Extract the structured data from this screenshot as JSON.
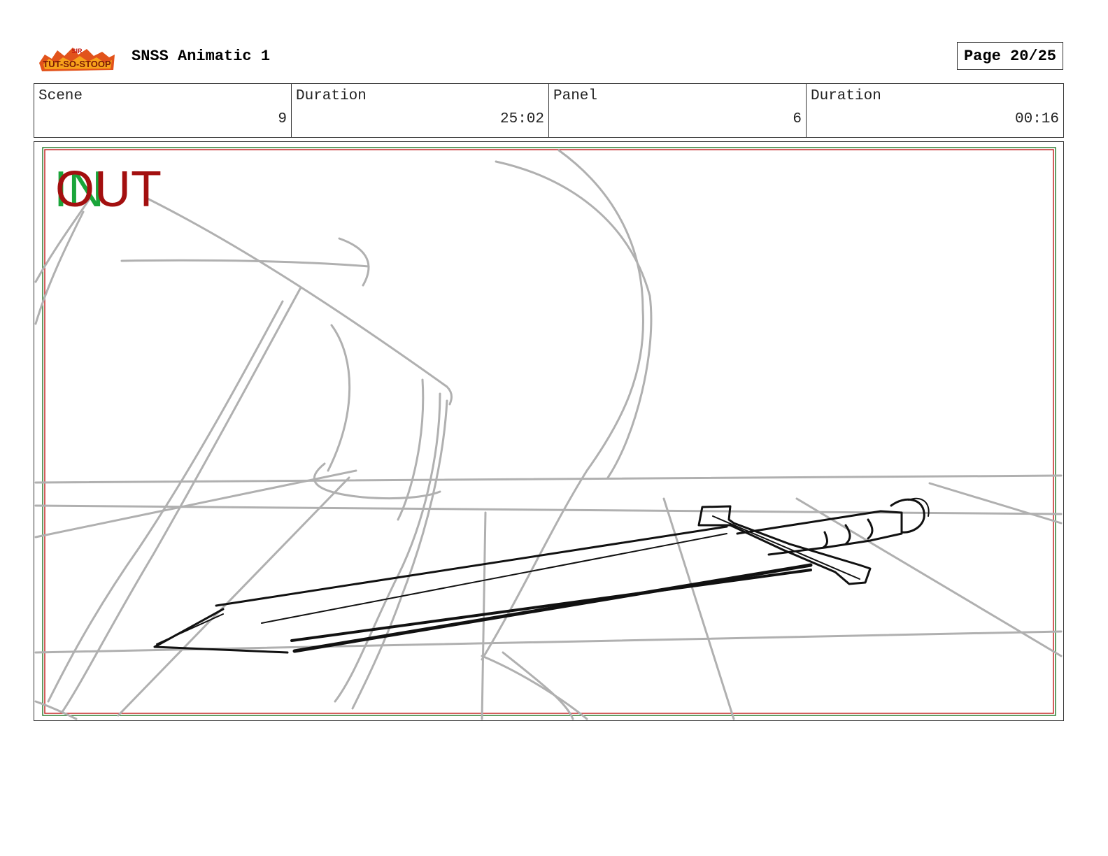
{
  "header": {
    "logo_text": "Sir Tut-So-Stoop",
    "title": "SNSS Animatic 1",
    "page": "Page 20/25"
  },
  "info": {
    "scene_label": "Scene",
    "scene_value": "9",
    "scene_duration_label": "Duration",
    "scene_duration_value": "25:02",
    "panel_label": "Panel",
    "panel_value": "6",
    "panel_duration_label": "Duration",
    "panel_duration_value": "00:16"
  },
  "panel": {
    "in_marker": "IN",
    "out_marker": "OUT",
    "colors": {
      "in": "#1aa53a",
      "out": "#a30f0f",
      "sketch_gray": "#b0b0b0",
      "ink": "#111111"
    }
  }
}
